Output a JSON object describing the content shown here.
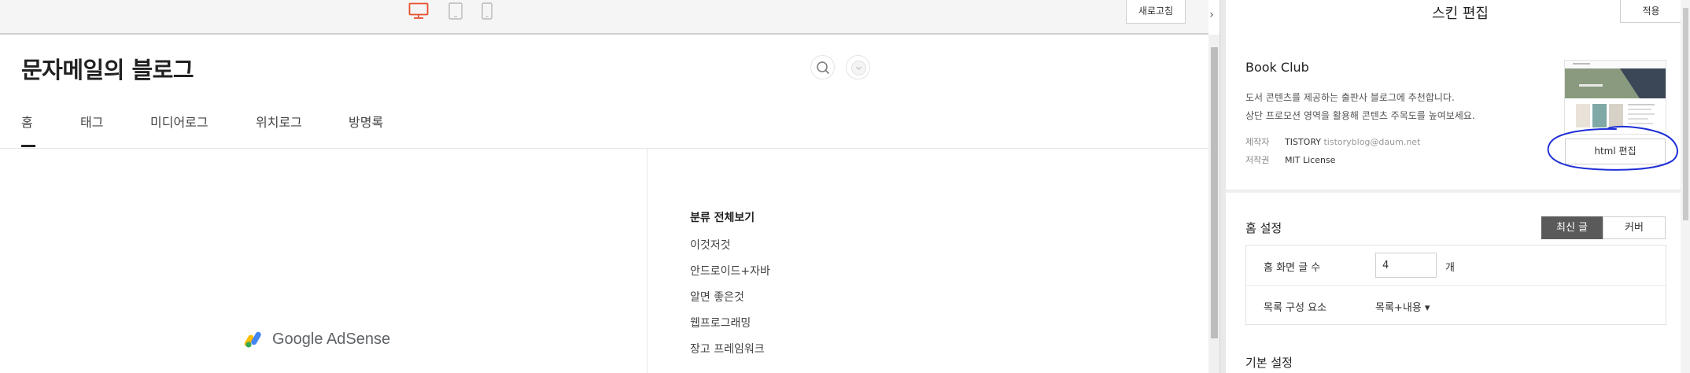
{
  "toolbar": {
    "devices": [
      "desktop-icon",
      "tablet-icon",
      "mobile-icon"
    ],
    "active_device": "desktop",
    "refresh_label": "새로고침",
    "collapse_glyph": "›"
  },
  "blog": {
    "title": "문자메일의 블로그",
    "nav": [
      "홈",
      "태그",
      "미디어로그",
      "위치로그",
      "방명록"
    ],
    "active_nav": "홈",
    "adsense_label": "Google AdSense",
    "categories": {
      "heading": "분류 전체보기",
      "items": [
        "이것저것",
        "안드로이드+자바",
        "알면 좋은것",
        "웹프로그래밍",
        "장고 프레임워크"
      ]
    }
  },
  "panel": {
    "title": "스킨 편집",
    "apply_label": "적용",
    "skin": {
      "name": "Book Club",
      "description_line1": "도서 콘텐츠를 제공하는 출판사 블로그에 추천합니다.",
      "description_line2": "상단 프로모션 영역을 활용해 콘텐츠 주목도를 높여보세요.",
      "author_key": "제작자",
      "author_value": "TISTORY",
      "author_email": "tistoryblog@daum.net",
      "license_key": "저작권",
      "license_value": "MIT License",
      "html_edit_label": "html 편집"
    },
    "home": {
      "label": "홈 설정",
      "toggle": [
        "최신 글",
        "커버"
      ],
      "selected_toggle": "최신 글",
      "post_count_label": "홈 화면 글 수",
      "post_count_value": "4",
      "post_count_unit": "개",
      "list_elements_label": "목록 구성 요소",
      "list_elements_value": "목록+내용 ▾"
    },
    "basic_label": "기본 설정"
  },
  "colors": {
    "active_device": "#e8502f",
    "annotation_ink": "#1f2fd6",
    "segment_active": "#5a5a5a"
  }
}
